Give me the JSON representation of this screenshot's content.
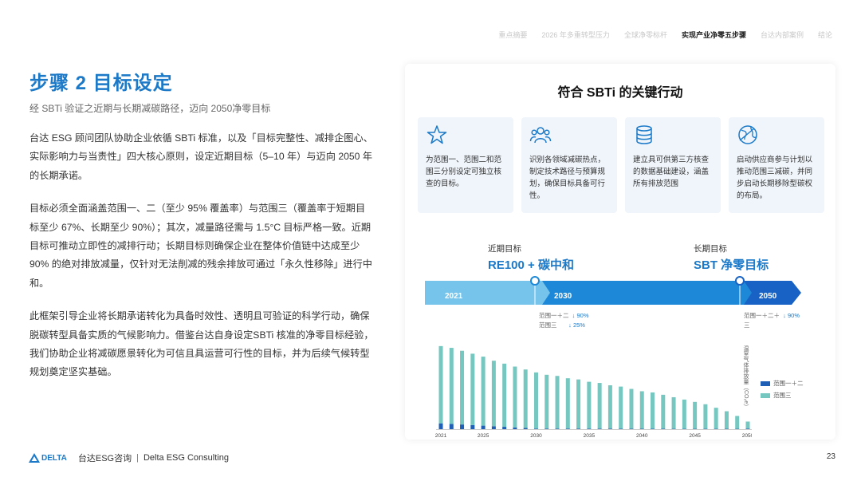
{
  "nav": {
    "items": [
      {
        "label": "重点摘要",
        "active": false
      },
      {
        "label": "2026 年多重转型压力",
        "active": false
      },
      {
        "label": "全球净零标杆",
        "active": false
      },
      {
        "label": "实现产业净零五步骤",
        "active": true
      },
      {
        "label": "台达内部案例",
        "active": false
      },
      {
        "label": "结论",
        "active": false
      }
    ]
  },
  "page": {
    "title": "步骤 2  目标设定",
    "subtitle": "经 SBTi 验证之近期与长期减碳路径，迈向 2050净零目标",
    "paragraphs": [
      "台达 ESG 顾问团队协助企业依循 SBTi 标准，以及「目标完整性、减排企图心、实际影响力与当责性」四大核心原则，设定近期目标（5–10 年）与迈向 2050 年的长期承诺。",
      "目标必须全面涵盖范围一、二（至少 95% 覆盖率）与范围三（覆盖率于短期目标至少 67%、长期至少 90%）；其次，减量路径需与 1.5°C 目标严格一致。近期目标可推动立即性的减排行动；长期目标则确保企业在整体价值链中达成至少 90% 的绝对排放减量，仅针对无法削减的残余排放可通过「永久性移除」进行中和。",
      "此框架引导企业将长期承诺转化为具备时效性、透明且可验证的科学行动，确保脱碳转型具备实质的气候影响力。借鉴台达自身设定SBTi 核准的净零目标经验，我们协助企业将减碳愿景转化为可信且具运营可行性的目标，并为后续气候转型规划奠定坚实基础。"
    ]
  },
  "panel": {
    "title": "符合 SBTi 的关键行动",
    "cards": [
      {
        "icon": "star-icon",
        "text": "为范围一、范围二和范围三分别设定可独立核查的目标。"
      },
      {
        "icon": "people-icon",
        "text": "识别各领域减碳热点，制定技术路径与预算规划，确保目标具备可行性。"
      },
      {
        "icon": "database-icon",
        "text": "建立具可供第三方核查的数据基础建设，涵盖所有排放范围"
      },
      {
        "icon": "globe-icon",
        "text": "启动供应商参与计划以推动范围三减碳，并同步启动长期移除型碳权的布局。"
      }
    ],
    "near_term": {
      "label": "近期目标",
      "value": "RE100 + 碳中和"
    },
    "long_term": {
      "label": "长期目标",
      "value": "SBT 净零目标"
    },
    "timeline_years": [
      "2021",
      "2030",
      "2050"
    ],
    "near_reductions": [
      {
        "scope": "范围一＋二",
        "value": "90%"
      },
      {
        "scope": "范围三",
        "value": "25%"
      }
    ],
    "long_reduction": {
      "scope_line1": "范围一＋二＋",
      "scope_line2": "三",
      "value": "90%"
    },
    "arrow_glyph": "↓",
    "chart_ylabel": "温室气体排放量（CO₂e）",
    "legend": [
      "范围一＋二",
      "范围三"
    ]
  },
  "chart_data": {
    "type": "bar",
    "stacked": true,
    "categories": [
      "2021",
      "2022",
      "2023",
      "2024",
      "2025",
      "2026",
      "2027",
      "2028",
      "2029",
      "2030",
      "2031",
      "2032",
      "2033",
      "2034",
      "2035",
      "2036",
      "2037",
      "2038",
      "2039",
      "2040",
      "2041",
      "2042",
      "2043",
      "2044",
      "2045",
      "2046",
      "2047",
      "2048",
      "2049",
      "2050"
    ],
    "x_tick_labels": [
      "2021",
      "2025",
      "2030",
      "2035",
      "2040",
      "2045",
      "2050"
    ],
    "series": [
      {
        "name": "范围一＋二",
        "color": "#1f5fb5",
        "values": [
          5,
          4.5,
          4,
          3.5,
          3,
          2.5,
          2,
          1.5,
          1,
          0.5,
          0.5,
          0.5,
          0.5,
          0.5,
          0.5,
          0.5,
          0.5,
          0.4,
          0.4,
          0.4,
          0.4,
          0.4,
          0.3,
          0.3,
          0.3,
          0.3,
          0.3,
          0.3,
          0.3,
          0.5
        ]
      },
      {
        "name": "范围三",
        "color": "#76c7c0",
        "values": [
          66,
          65,
          63,
          61,
          59,
          56,
          54,
          52,
          50,
          48,
          46,
          45,
          43,
          42,
          40,
          39,
          37,
          36,
          34,
          32,
          31,
          29,
          27,
          25,
          23,
          21,
          18,
          15,
          11,
          6
        ]
      }
    ],
    "ylim": [
      0,
      75
    ],
    "ylabel": "温室气体排放量（CO₂e）"
  }
}
